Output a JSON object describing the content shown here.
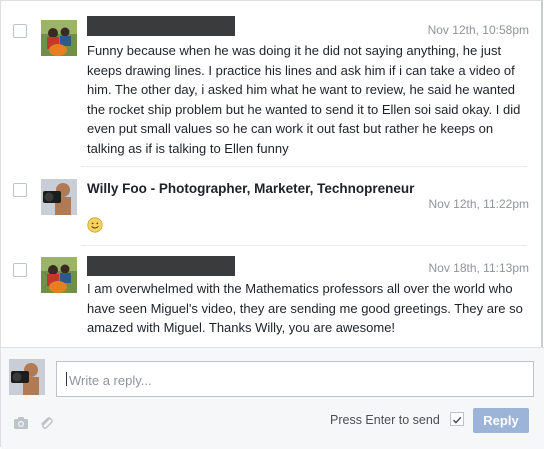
{
  "messages": [
    {
      "sender": "",
      "sender_redacted": true,
      "time": "Nov 12th, 10:58pm",
      "body": "Funny because when he was doing it he did not saying anything, he just keeps drawing lines. I practice his lines and ask him if i can take a video of him. The other day, i asked him what he want to review, he said he wanted the rocket ship problem but he wanted to send it to Ellen soi said okay. I did even put small values so he can work it out fast but rather he keeps on talking as if is talking to Ellen funny"
    },
    {
      "sender": "Willy Foo - Photographer, Marketer, Technopreneur",
      "sender_redacted": false,
      "time": "Nov 12th, 11:22pm",
      "body": "",
      "emoji": "smiley-emoji"
    },
    {
      "sender": "",
      "sender_redacted": true,
      "time": "Nov 18th, 11:13pm",
      "body": "I am overwhelmed with the Mathematics professors all over the world who have seen Miguel's video, they are sending me good greetings. They are so amazed with Miguel. Thanks Willy, you are awesome!"
    }
  ],
  "composer": {
    "placeholder": "Write a reply...",
    "value": "",
    "press_enter_label": "Press Enter to send",
    "press_enter_checked": true,
    "reply_label": "Reply",
    "icons": [
      "camera-icon",
      "paperclip-icon"
    ]
  },
  "colors": {
    "reply_button": "#9cb4d8",
    "timestamp": "#90949c",
    "separator": "#e9ebee",
    "redaction": "#3a3b3c"
  }
}
